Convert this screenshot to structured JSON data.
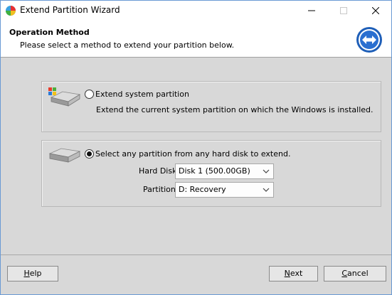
{
  "window": {
    "title": "Extend Partition Wizard"
  },
  "header": {
    "title": "Operation Method",
    "subtitle": "Please select a method to extend your partition below."
  },
  "option_system": {
    "label": "Extend system partition",
    "description": "Extend the current system partition on which the Windows is installed.",
    "selected": false
  },
  "option_any": {
    "label": "Select any partition from any hard disk to extend.",
    "selected": true,
    "hard_disk_label": "Hard Disk",
    "hard_disk_value": "Disk 1 (500.00GB)",
    "partition_label": "Partition",
    "partition_value": "D: Recovery"
  },
  "buttons": {
    "help_mnemonic": "H",
    "help_rest": "elp",
    "next_mnemonic": "N",
    "next_rest": "ext",
    "cancel_mnemonic": "C",
    "cancel_rest": "ancel"
  },
  "colors": {
    "accent": "#2a6fd0",
    "window_border": "#6a9ad4",
    "panel": "#d8d8d8"
  }
}
